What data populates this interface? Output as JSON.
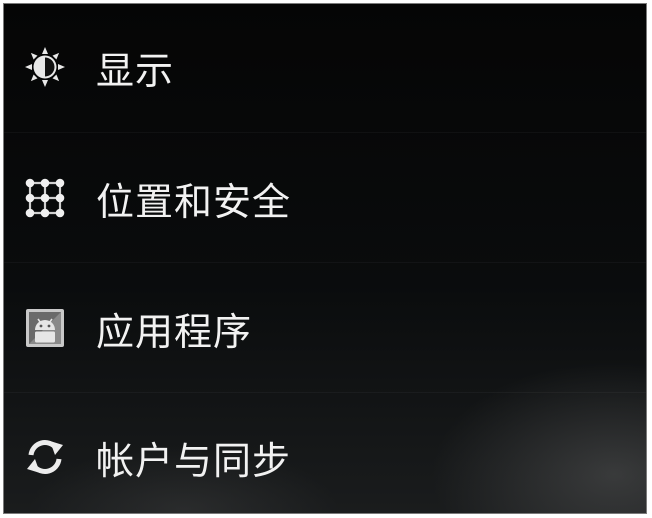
{
  "settings_menu": {
    "items": [
      {
        "label": "显示",
        "icon": "brightness-icon"
      },
      {
        "label": "位置和安全",
        "icon": "location-security-icon"
      },
      {
        "label": "应用程序",
        "icon": "android-apps-icon"
      },
      {
        "label": "帐户与同步",
        "icon": "sync-icon"
      }
    ]
  }
}
